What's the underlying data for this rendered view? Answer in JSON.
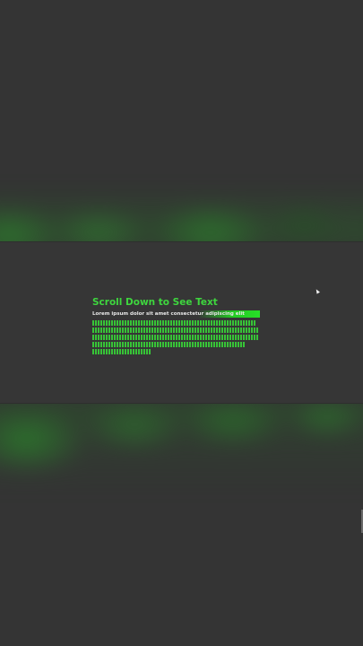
{
  "section": {
    "title": "Scroll Down to See Text",
    "lorem": "Lorem ipsum dolor sit amet consectetur adipiscing elit"
  },
  "placeholder_glyph_rows": [
    61,
    62,
    62,
    57,
    22
  ],
  "colors": {
    "background": "#343434",
    "panel": "#363636",
    "accent_green": "#3ed63e",
    "highlight_green": "#22c922",
    "text_light": "#e8e8e8"
  },
  "cursor_icon": "mouse-pointer-icon"
}
